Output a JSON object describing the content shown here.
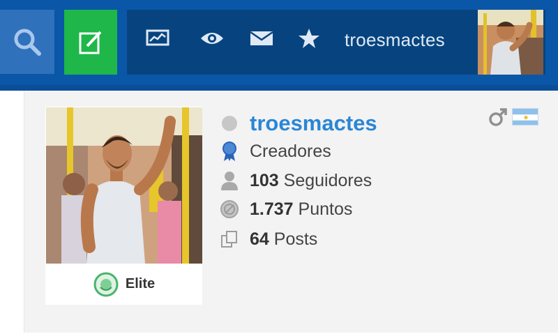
{
  "nav": {
    "username": "troesmactes",
    "icons": [
      "search-icon",
      "new-post-icon",
      "stats-icon",
      "eye-icon",
      "mail-icon",
      "star-icon"
    ]
  },
  "profile": {
    "username": "troesmactes",
    "group": "Creadores",
    "followers_count": "103",
    "followers_label": "Seguidores",
    "points_count": "1.737",
    "points_label": "Puntos",
    "posts_count": "64",
    "posts_label": "Posts",
    "rank": "Elite",
    "gender": "male",
    "country": "Argentina"
  },
  "colors": {
    "topbar": "#0a57a8",
    "nav_strip": "#07447f",
    "search_button": "#2f71bb",
    "new_post_button": "#1fb74a",
    "username": "#2a86d6",
    "card_background": "#f3f3f3"
  }
}
